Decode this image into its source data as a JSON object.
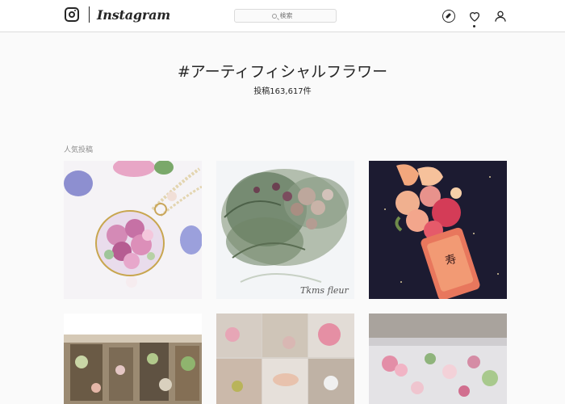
{
  "header": {
    "wordmark": "Instagram",
    "search": {
      "placeholder": "検索"
    }
  },
  "hashtag": {
    "title": "#アーティフィシャルフラワー",
    "post_count": "投稿163,617件"
  },
  "section": {
    "label": "人気投稿"
  },
  "posts": [
    {
      "watermark": ""
    },
    {
      "watermark": "Tkms fleur"
    },
    {
      "watermark": ""
    },
    {
      "watermark": ""
    },
    {
      "watermark": ""
    },
    {
      "watermark": ""
    }
  ],
  "icons": {
    "logo": "instagram-glyph-icon",
    "search": "search-icon",
    "explore": "compass-icon",
    "activity": "heart-icon",
    "profile": "user-icon"
  }
}
